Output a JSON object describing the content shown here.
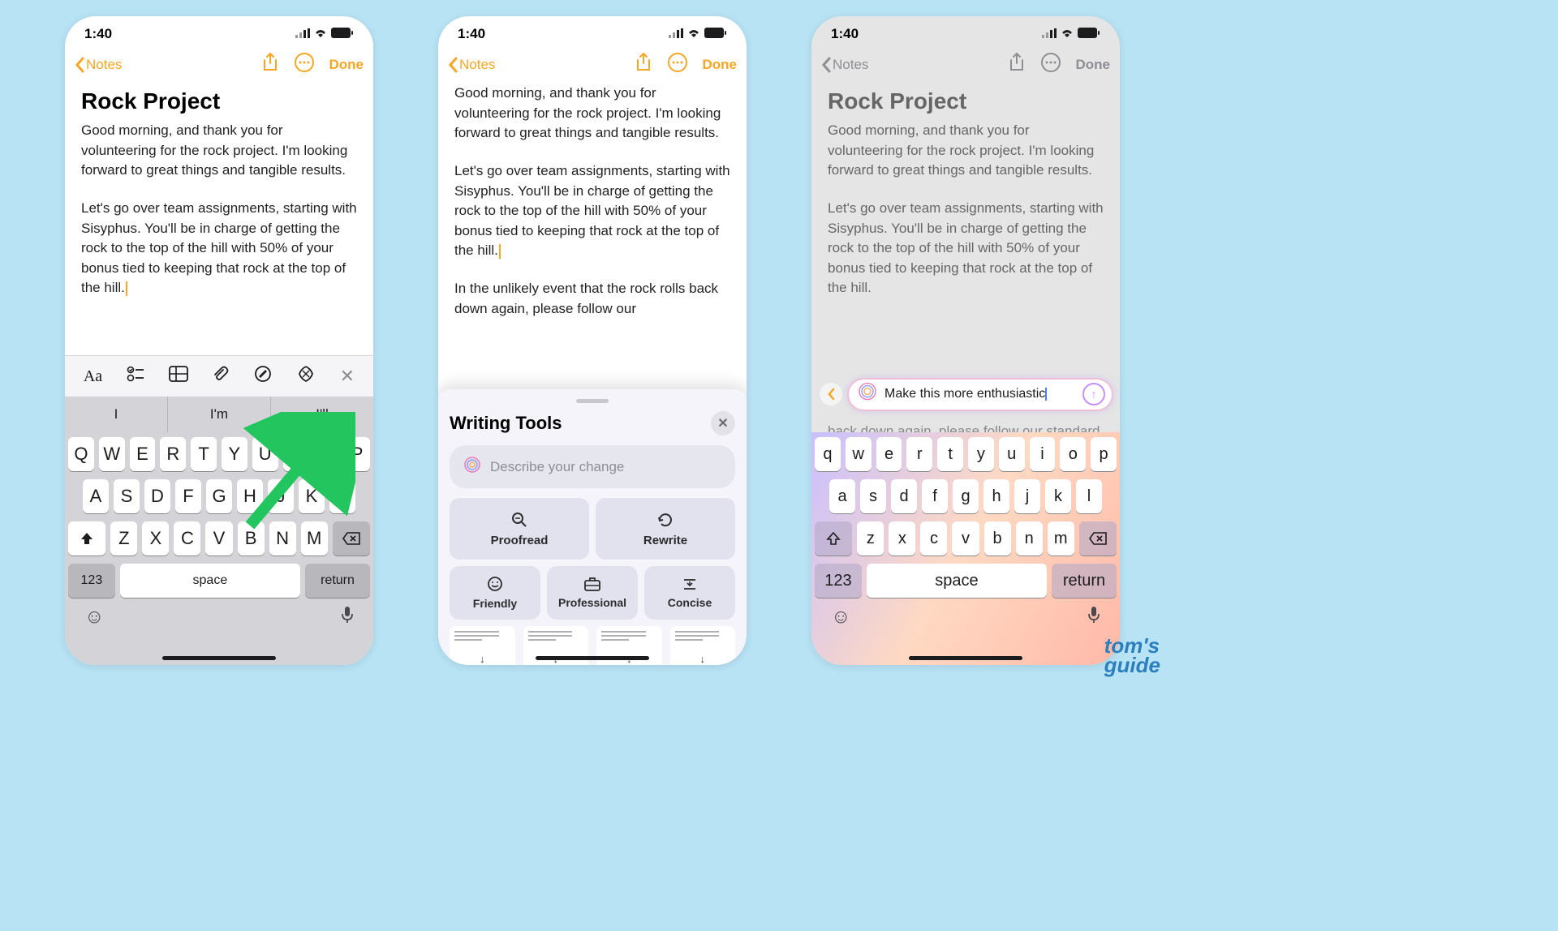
{
  "status": {
    "time": "1:40"
  },
  "nav": {
    "back_label": "Notes",
    "done_label": "Done"
  },
  "note": {
    "title": "Rock Project",
    "para1": "Good morning, and thank you for volunteering for the rock project. I'm looking forward to great things and tangible results.",
    "para2": "Let's go over team assignments, starting with Sisyphus. You'll be in charge of getting the rock to the top of the hill with 50% of your bonus tied to keeping that rock at the top of the hill.",
    "para3": "In the unlikely event that the rock rolls back down again, please follow our",
    "para3_more": "back down again, please follow our standard procedure by trying to get"
  },
  "predictions": {
    "a": "I",
    "b": "I'm",
    "c": "I'll"
  },
  "keyboard": {
    "row1": [
      "Q",
      "W",
      "E",
      "R",
      "T",
      "Y",
      "U",
      "I",
      "O",
      "P"
    ],
    "row2": [
      "A",
      "S",
      "D",
      "F",
      "G",
      "H",
      "J",
      "K",
      "L"
    ],
    "row3": [
      "Z",
      "X",
      "C",
      "V",
      "B",
      "N",
      "M"
    ],
    "num_label": "123",
    "space_label": "space",
    "return_label": "return"
  },
  "writing_tools": {
    "title": "Writing Tools",
    "describe_placeholder": "Describe your change",
    "proofread": "Proofread",
    "rewrite": "Rewrite",
    "friendly": "Friendly",
    "professional": "Professional",
    "concise": "Concise"
  },
  "ai_prompt": {
    "text": "Make this more enthusiastic"
  },
  "watermark": "tom's guide"
}
